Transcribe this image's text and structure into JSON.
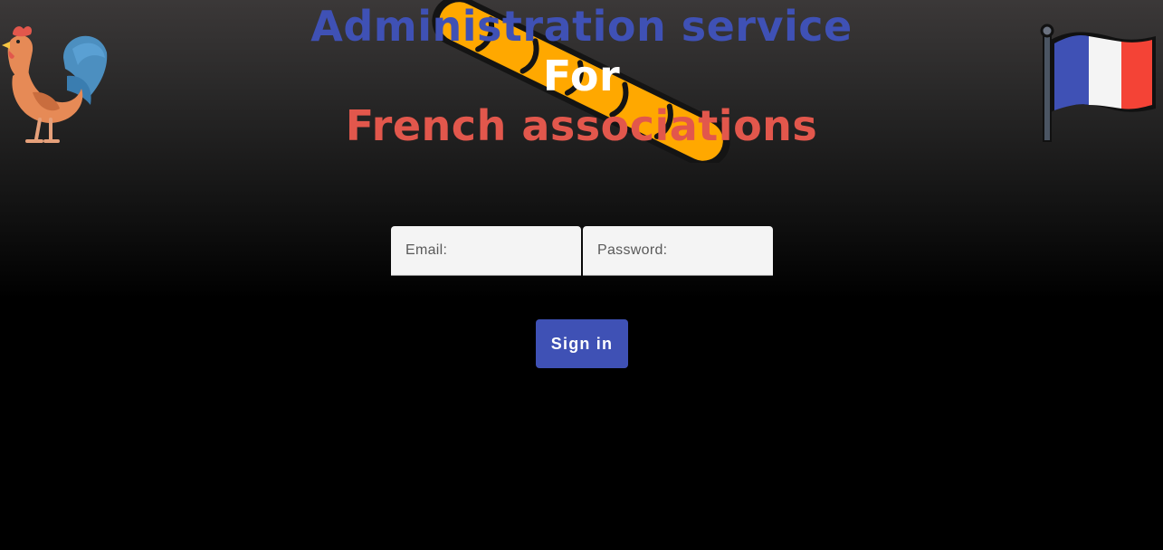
{
  "colors": {
    "title_blue": "#3f51b5",
    "title_white": "#ffffff",
    "title_red": "#e2574c",
    "button_bg": "#3f51b5",
    "baguette": "#ffa800"
  },
  "header": {
    "line1": "Administration service",
    "line2": "For",
    "line3": "French associations",
    "left_icon": "rooster-icon",
    "right_icon": "french-flag-icon",
    "center_icon": "baguette-icon"
  },
  "login": {
    "email_label": "Email:",
    "password_label": "Password:",
    "submit_label": "Sign in"
  }
}
